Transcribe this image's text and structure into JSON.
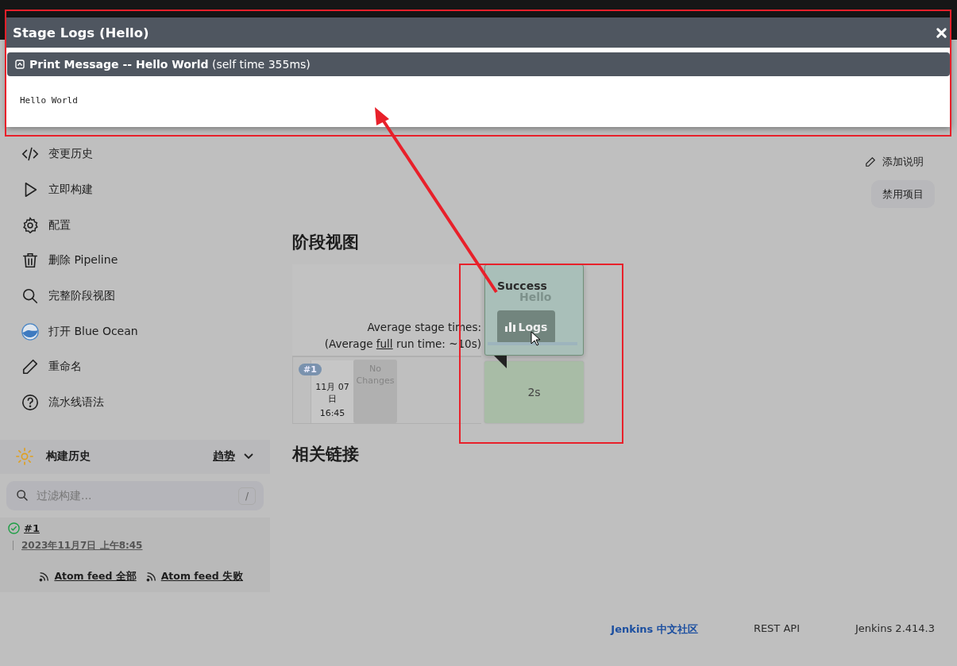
{
  "modal": {
    "title": "Stage Logs (Hello)",
    "step": {
      "name": "Print Message -- Hello World",
      "detail": "(self time 355ms)",
      "expanded": true
    },
    "log": "Hello World"
  },
  "sidebar": {
    "items": [
      {
        "kind": "code",
        "label": "变更历史"
      },
      {
        "kind": "play",
        "label": "立即构建"
      },
      {
        "kind": "gear",
        "label": "配置"
      },
      {
        "kind": "trash",
        "label": "删除 Pipeline"
      },
      {
        "kind": "search",
        "label": "完整阶段视图"
      },
      {
        "kind": "ocean",
        "label": "打开 Blue Ocean"
      },
      {
        "kind": "pencil",
        "label": "重命名"
      },
      {
        "kind": "help",
        "label": "流水线语法"
      }
    ]
  },
  "build_history": {
    "title": "构建历史",
    "trend": "趋势",
    "filter_placeholder": "过滤构建...",
    "shortcut": "/",
    "builds": [
      {
        "number": "#1",
        "date": "2023年11月7日 上午8:45",
        "success": true
      }
    ],
    "feeds": [
      "Atom feed 全部",
      "Atom feed 失败"
    ]
  },
  "actions": {
    "add_description": "添加说明",
    "disable": "禁用项目"
  },
  "stage_view": {
    "title": "阶段视图",
    "avg_label": "Average stage times:",
    "avg_run_before": "(Average ",
    "avg_run_link": "full",
    "avg_run_after": " run time: ~10s)",
    "runs": [
      {
        "badge": "#1",
        "date": "11月 07 日",
        "time": "16:45",
        "changes": "No Changes",
        "cells": [
          "2s"
        ]
      }
    ],
    "popover": {
      "status": "Success",
      "stage": "Hello",
      "button": "Logs"
    }
  },
  "related": {
    "title": "相关链接"
  },
  "footer": [
    {
      "kind": "link",
      "label": "Jenkins 中文社区"
    },
    {
      "kind": "text",
      "label": "REST API"
    },
    {
      "kind": "text",
      "label": "Jenkins 2.414.3"
    }
  ]
}
